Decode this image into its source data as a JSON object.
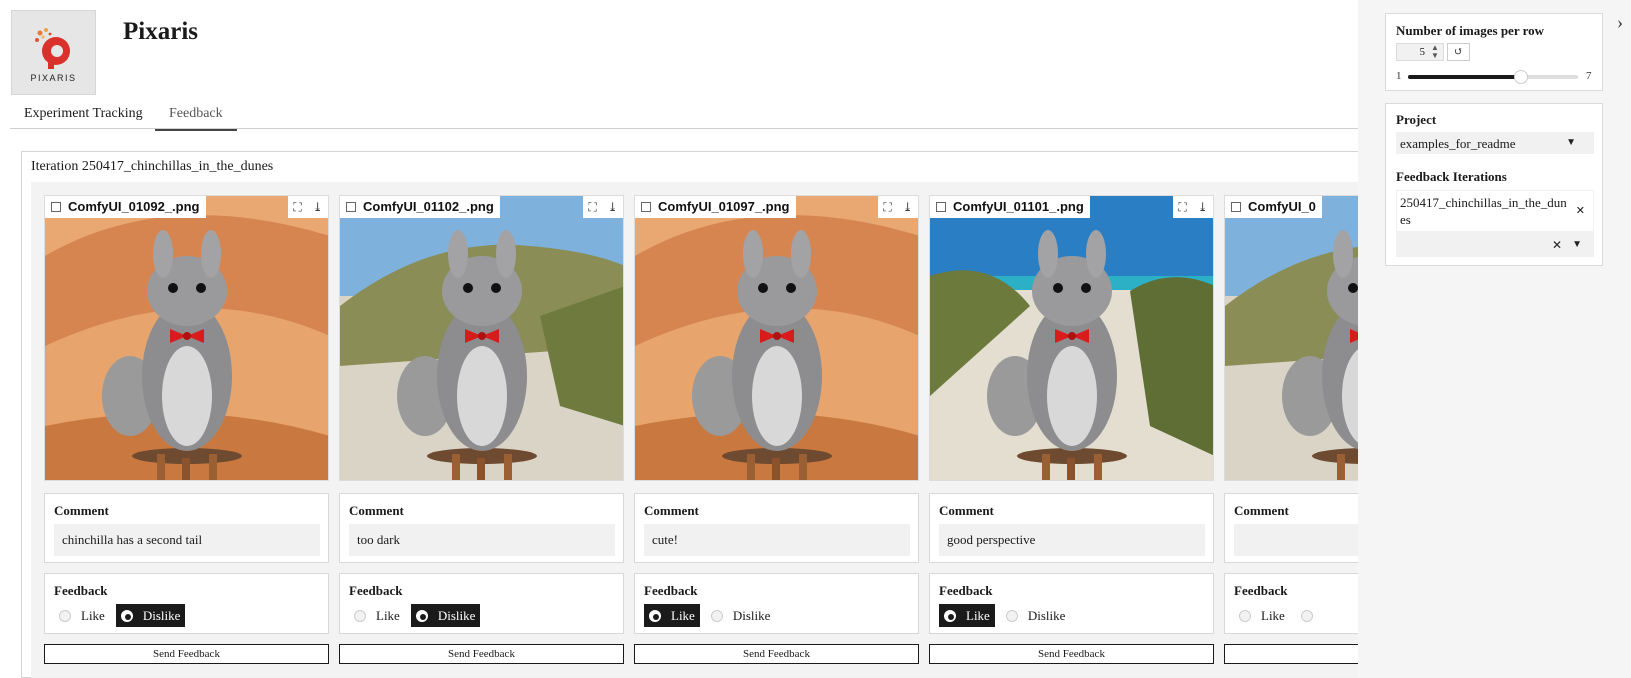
{
  "app": {
    "title": "Pixaris",
    "logo_text": "PIXARIS"
  },
  "tabs": [
    {
      "label": "Experiment Tracking"
    },
    {
      "label": "Feedback"
    }
  ],
  "iteration": {
    "title": "Iteration 250417_chinchillas_in_the_dunes",
    "cards": [
      {
        "filename": "ComfyUI_01092_.png",
        "comment_label": "Comment",
        "comment": "chinchilla has a second tail",
        "feedback_label": "Feedback",
        "like_label": "Like",
        "dislike_label": "Dislike",
        "selected": "dislike",
        "send_label": "Send Feedback",
        "scene": "desert"
      },
      {
        "filename": "ComfyUI_01102_.png",
        "comment_label": "Comment",
        "comment": "too dark",
        "feedback_label": "Feedback",
        "like_label": "Like",
        "dislike_label": "Dislike",
        "selected": "dislike",
        "send_label": "Send Feedback",
        "scene": "dunes"
      },
      {
        "filename": "ComfyUI_01097_.png",
        "comment_label": "Comment",
        "comment": "cute!",
        "feedback_label": "Feedback",
        "like_label": "Like",
        "dislike_label": "Dislike",
        "selected": "like",
        "send_label": "Send Feedback",
        "scene": "desert"
      },
      {
        "filename": "ComfyUI_01101_.png",
        "comment_label": "Comment",
        "comment": "good perspective",
        "feedback_label": "Feedback",
        "like_label": "Like",
        "dislike_label": "Dislike",
        "selected": "like",
        "send_label": "Send Feedback",
        "scene": "beach"
      },
      {
        "filename": "ComfyUI_0",
        "comment_label": "Comment",
        "comment": "",
        "feedback_label": "Feedback",
        "like_label": "Like",
        "dislike_label": "",
        "selected": "none",
        "send_label": "",
        "scene": "dunes"
      }
    ]
  },
  "sidebar": {
    "images_per_row": {
      "label": "Number of images per row",
      "value": "5",
      "min_label": "1",
      "max_label": "7",
      "min": 1,
      "max": 7,
      "current": 5
    },
    "project": {
      "label": "Project",
      "value": "examples_for_readme"
    },
    "feedback_iterations": {
      "label": "Feedback Iterations",
      "selected_tag": "250417_chinchillas_in_the_dunes"
    }
  },
  "icons": {
    "collapse": "chevron-right-icon",
    "fullscreen": "fullscreen-icon",
    "download": "download-icon",
    "reset": "reset-icon",
    "image": "image-file-icon"
  },
  "colors": {
    "accent": "#1a1a1a",
    "sidebar_bg": "#f5f5f5",
    "panel_bg": "#f3f3f3",
    "logo_red": "#d9312b"
  }
}
